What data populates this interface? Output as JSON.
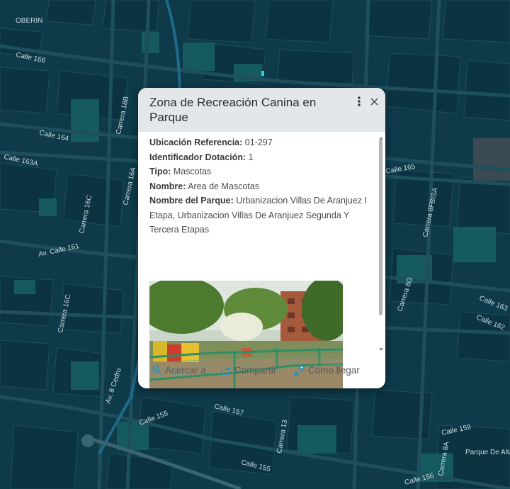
{
  "map": {
    "street_labels": [
      "OBERIN",
      "Calle 166",
      "Carrera 18B",
      "Calle 164",
      "Calle 163A",
      "Carrera 16A",
      "Carrera 16C",
      "Av. Calle 161",
      "Carrera 16C",
      "Av. 8 Cedro",
      "Calle 157",
      "Calle 155",
      "Carrera 13",
      "Calle 155",
      "Calle 165",
      "Carrera 8FBISA",
      "Carrera 8G",
      "Calle 163",
      "Calle 162",
      "Calle 159",
      "Carrera 8A",
      "Parque De Alta",
      "Calle 156"
    ],
    "colors": {
      "background": "#0e3a4a",
      "block": "#0b3342",
      "park": "#155a5f",
      "street": "#1f4e5c"
    }
  },
  "popup": {
    "title": "Zona de Recreación Canina en Parque",
    "menu_icon": "more-vertical-icon",
    "close_icon": "close-icon",
    "fields": [
      {
        "label": "Ubicación Referencia:",
        "value": "01-297"
      },
      {
        "label": "Identificador Dotación:",
        "value": "1"
      },
      {
        "label": "Tipo:",
        "value": "Mascotas"
      },
      {
        "label": "Nombre:",
        "value": "Area de Mascotas"
      },
      {
        "label": "Nombre del Parque:",
        "value": "Urbanizacion Villas De Aranjuez I Etapa, Urbanizacion Villas De Aranjuez Segunda Y Tercera Etapas"
      }
    ],
    "actions": [
      {
        "label": "Acercar a",
        "icon": "zoom-in-icon"
      },
      {
        "label": "Compartir",
        "icon": "share-icon"
      },
      {
        "label": "Cómo llegar",
        "icon": "directions-icon"
      }
    ],
    "accent_color": "#2b8fb6"
  }
}
